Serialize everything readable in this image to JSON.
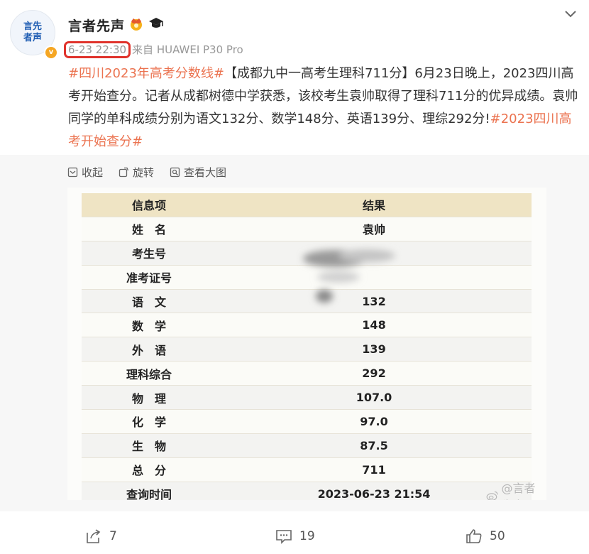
{
  "user": {
    "avatar_line1": "言先",
    "avatar_line2": "者声",
    "name": "言者先声"
  },
  "post": {
    "time": "6-23 22:30",
    "source": "来自 HUAWEI P30 Pro",
    "tag1": "#四川2023年高考分数线#",
    "body1": "【成都九中一高考生理科711分】6月23日晚上，2023四川高考开始查分。记者从成都树德中学获悉，该校考生袁帅取得了理科711分的优异成绩。袁帅同学的单科成绩分别为语文132分、数学148分、英语139分、理综292分!",
    "tag2": "#2023四川高考开始查分#"
  },
  "image_toolbar": {
    "collapse": "收起",
    "rotate": "旋转",
    "view_large": "查看大图"
  },
  "table": {
    "header": [
      "信息项",
      "结果"
    ],
    "rows": [
      [
        "姓　名",
        "袁帅"
      ],
      [
        "考生号",
        ""
      ],
      [
        "准考证号",
        ""
      ],
      [
        "语　文",
        "132"
      ],
      [
        "数　学",
        "148"
      ],
      [
        "外　语",
        "139"
      ],
      [
        "理科综合",
        "292"
      ],
      [
        "物　理",
        "107.0"
      ],
      [
        "化　学",
        "97.0"
      ],
      [
        "生　物",
        "87.5"
      ],
      [
        "总　分",
        "711"
      ],
      [
        "查询时间",
        "2023-06-23 21:54"
      ]
    ]
  },
  "watermark": "@言者先声",
  "actions": {
    "share_count": "7",
    "comment_count": "19",
    "like_count": "50"
  },
  "colors": {
    "tag": "#eb7350",
    "highlight_box": "#e0332c",
    "table_header": "#efe4c4"
  }
}
